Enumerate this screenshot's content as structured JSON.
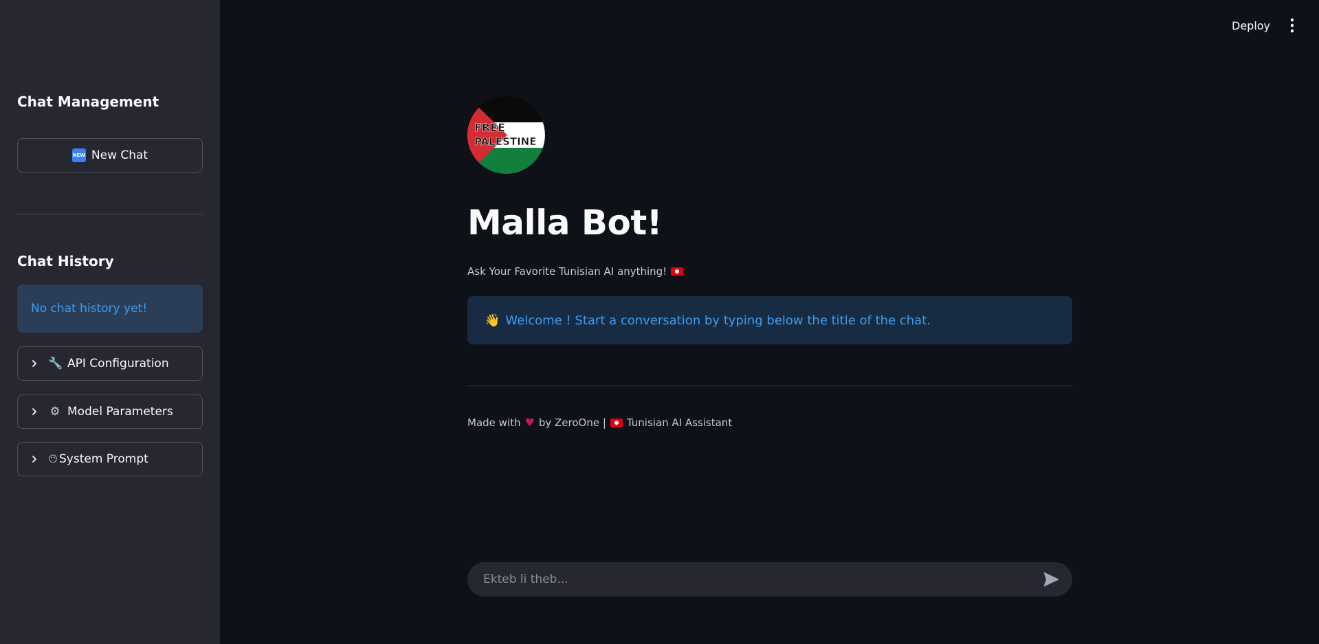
{
  "topbar": {
    "deploy_label": "Deploy",
    "menu_icon": "kebab-menu-icon"
  },
  "sidebar": {
    "management_heading": "Chat Management",
    "new_chat_badge": "NEW",
    "new_chat_label": "New Chat",
    "history_heading": "Chat History",
    "history_empty": "No chat history yet!",
    "expanders": [
      {
        "icon": "🔧",
        "label": "API Configuration"
      },
      {
        "icon": "⚙",
        "label": "Model Parameters"
      },
      {
        "icon": "😶",
        "label": "System Prompt"
      }
    ]
  },
  "main": {
    "logo_text_line1": "FREE",
    "logo_text_line2": "PALESTINE",
    "title": "Malla Bot!",
    "subtitle": "Ask Your Favorite Tunisian AI anything!",
    "welcome_icon": "👋",
    "welcome_text": "Welcome ! Start a conversation by typing below the title of the chat.",
    "footer_prefix": "Made with",
    "footer_heart": "♥",
    "footer_by": "by ZeroOne |",
    "footer_suffix": "Tunisian AI Assistant"
  },
  "chat_input": {
    "placeholder": "Ekteb li theb..."
  },
  "colors": {
    "background": "#0e1117",
    "sidebar": "#262730",
    "info_text": "#3d9df3",
    "info_bg": "rgba(61,157,243,0.2)"
  }
}
